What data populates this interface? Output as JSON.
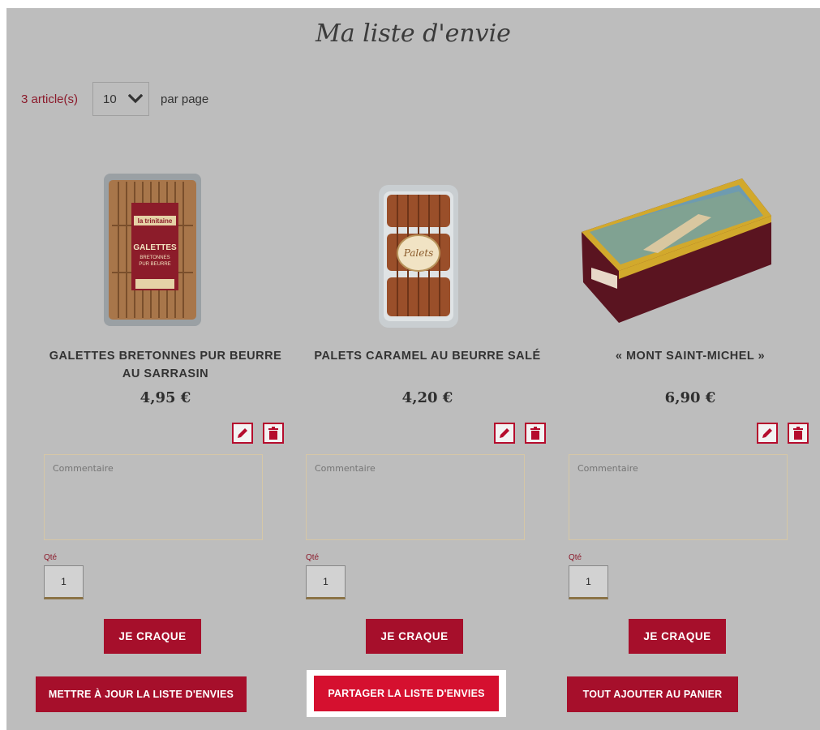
{
  "page": {
    "title": "Ma liste d'envie"
  },
  "toolbar": {
    "count": "3 article(s)",
    "per_page_value": "10",
    "per_page_label": "par page"
  },
  "products": [
    {
      "name": "GALETTES BRETONNES PUR BEURRE AU SARRASIN",
      "price": "4,95 €",
      "comment_placeholder": "Commentaire",
      "qty_label": "Qté",
      "qty": "1",
      "buy_label": "JE CRAQUE"
    },
    {
      "name": "PALETS CARAMEL AU BEURRE SALÉ",
      "price": "4,20 €",
      "comment_placeholder": "Commentaire",
      "qty_label": "Qté",
      "qty": "1",
      "buy_label": "JE CRAQUE"
    },
    {
      "name": "« MONT SAINT-MICHEL »",
      "price": "6,90 €",
      "comment_placeholder": "Commentaire",
      "qty_label": "Qté",
      "qty": "1",
      "buy_label": "JE CRAQUE"
    }
  ],
  "product_images": {
    "galettes_pack_text": [
      "la trinitaine",
      "GALETTES",
      "BRETONNES",
      "PUR BEURRE"
    ],
    "palets_pack_text": "Palets"
  },
  "icons": {
    "edit": "pencil-icon",
    "delete": "trash-icon",
    "dropdown": "chevron-down-icon"
  },
  "actions": {
    "update": "METTRE À JOUR LA LISTE D'ENVIES",
    "share": "PARTAGER LA LISTE D'ENVIES",
    "add_all": "TOUT AJOUTER AU PANIER"
  },
  "colors": {
    "accent": "#a60f2b",
    "accent_bright": "#d5102f",
    "overlay": "#bdbdbd",
    "count_text": "#8b1a2b"
  }
}
